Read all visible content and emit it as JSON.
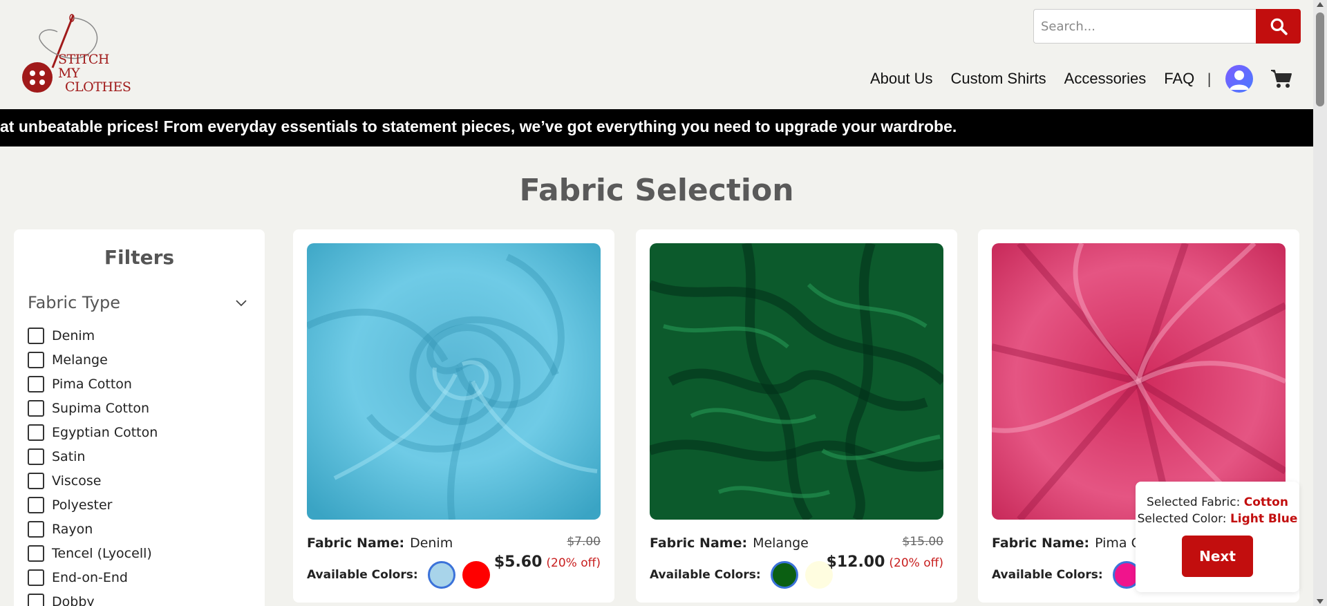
{
  "brand": {
    "line1": "STITCH MY",
    "line2": "CLOTHES",
    "accent": "#c20e0e"
  },
  "search": {
    "placeholder": "Search...",
    "icon": "search-icon"
  },
  "nav": {
    "items": [
      "About Us",
      "Custom Shirts",
      "Accessories",
      "FAQ"
    ],
    "separator": "|",
    "profile_icon": "user-avatar-icon",
    "cart_icon": "cart-icon"
  },
  "marquee": {
    "text": "at unbeatable prices! From everyday essentials to statement pieces, we’ve got everything you need to upgrade your wardrobe."
  },
  "page": {
    "title": "Fabric Selection"
  },
  "filters": {
    "title": "Filters",
    "group": "Fabric Type",
    "options": [
      "Denim",
      "Melange",
      "Pima Cotton",
      "Supima Cotton",
      "Egyptian Cotton",
      "Satin",
      "Viscose",
      "Polyester",
      "Rayon",
      "Tencel (Lyocell)",
      "End-on-End",
      "Dobby"
    ]
  },
  "products": [
    {
      "label": "Fabric Name:",
      "name": "Denim",
      "original_price": "$7.00",
      "price": "$5.60",
      "discount": "(20% off)",
      "colors_label": "Available Colors:",
      "colors": [
        "#a8d4ea",
        "#ff0000"
      ]
    },
    {
      "label": "Fabric Name:",
      "name": "Melange",
      "original_price": "$15.00",
      "price": "$12.00",
      "discount": "(20% off)",
      "colors_label": "Available Colors:",
      "colors": [
        "#0b5f12",
        "#fffde0"
      ]
    },
    {
      "label": "Fabric Name:",
      "name": "Pima Cot",
      "original_price": "",
      "price": "",
      "discount": "",
      "colors_label": "Available Colors:",
      "colors": [
        "#f0148c",
        "#f7bccf"
      ]
    }
  ],
  "selection": {
    "fabric_label": "Selected Fabric:",
    "fabric_value": "Cotton",
    "color_label": "Selected Color:",
    "color_value": "Light Blue",
    "next_label": "Next"
  }
}
